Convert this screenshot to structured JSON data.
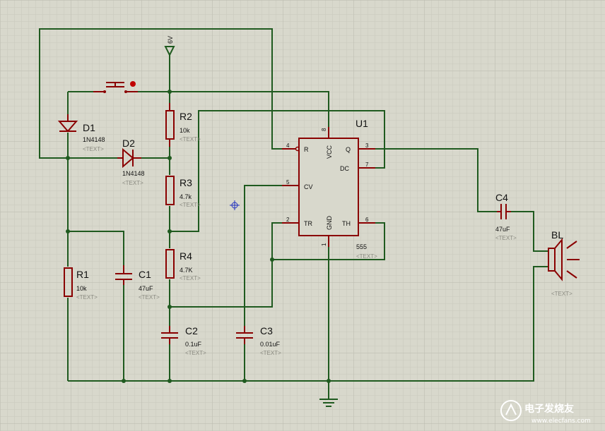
{
  "grid": {
    "minor_color": "#c9c9bd",
    "major_color": "#b9b9ad"
  },
  "colors": {
    "wire": "#1f5a1f",
    "component": "#8a0000",
    "background": "#d8d8cc"
  },
  "power": {
    "label": "6V"
  },
  "components": {
    "D1": {
      "ref": "D1",
      "value": "1N4148",
      "text": "<TEXT>"
    },
    "D2": {
      "ref": "D2",
      "value": "1N4148",
      "text": "<TEXT>"
    },
    "R1": {
      "ref": "R1",
      "value": "10k",
      "text": "<TEXT>"
    },
    "R2": {
      "ref": "R2",
      "value": "10k",
      "text": "<TEXT>"
    },
    "R3": {
      "ref": "R3",
      "value": "4.7k",
      "text": "<TEXT>"
    },
    "R4": {
      "ref": "R4",
      "value": "4.7K",
      "text": "<TEXT>"
    },
    "C1": {
      "ref": "C1",
      "value": "47uF",
      "text": "<TEXT>"
    },
    "C2": {
      "ref": "C2",
      "value": "0.1uF",
      "text": "<TEXT>"
    },
    "C3": {
      "ref": "C3",
      "value": "0.01uF",
      "text": "<TEXT>"
    },
    "C4": {
      "ref": "C4",
      "value": "47uF",
      "text": "<TEXT>"
    },
    "BL": {
      "ref": "BL",
      "text": "<TEXT>"
    }
  },
  "ic": {
    "ref": "U1",
    "value": "555",
    "text": "<TEXT>",
    "pins": {
      "R": "R",
      "VCC": "VCC",
      "Q": "Q",
      "DC": "DC",
      "CV": "CV",
      "TR": "TR",
      "GND": "GND",
      "TH": "TH",
      "n1": "1",
      "n2": "2",
      "n3": "3",
      "n4": "4",
      "n5": "5",
      "n6": "6",
      "n7": "7",
      "n8": "8"
    }
  },
  "watermark": {
    "text": "电子发烧友",
    "url": "www.elecfans.com"
  }
}
